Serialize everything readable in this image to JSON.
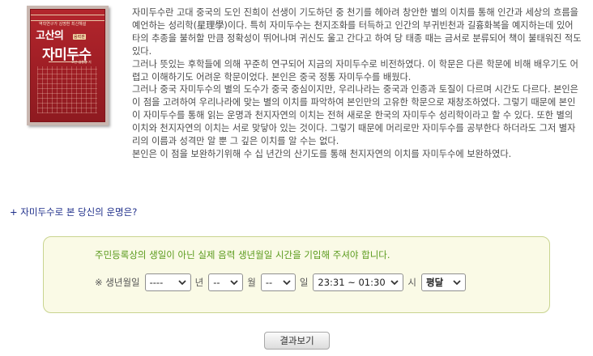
{
  "book_cover": {
    "subtitle": "역학연구가 김명환 최신해설",
    "title_line1": "고산의",
    "tag": "음력판",
    "title_line2": "자미두수",
    "author": "고산 김종웅 저"
  },
  "intro": {
    "paragraphs": [
      "자미두수란 고대 중국의 도인 진희이 선생이 기도하던 중 천기를 헤아려 창안한 별의 이치를 통해 인간과 세상의 흐름을 예언하는 성리학(星理學)이다. 특히 자미두수는 천지조화를 터득하고 인간의 부귀빈천과 길흉화복을 예지하는데 있어 타의 추종을 불허할 만큼 정확성이 뛰어나며 귀신도 울고 간다고 하여 당 태종 때는 금서로 분류되어 책이 불태워진 적도 있다.",
      "그러나 뜻있는 후학들에 의해 꾸준히 연구되어 지금의 자미두수로 비전하였다. 이 학문은 다른 학문에 비해 배우기도 어렵고 이해하기도 어려운 학문이었다. 본인은 중국 정통 자미두수를 배웠다.",
      "그러나 중국 자미두수의 별의 도수가 중국 중심이지만, 우리나라는 중국과 인종과 토질이 다르며 시간도 다르다. 본인은 이 점을 고려하여 우리나라에 맞는 별의 이치를 파악하여 본인만의 고유한 학문으로 재창조하였다. 그렇기 때문에 본인이 자미두수를 통해 읽는 운명과 천지자연의 이치는 전혀 새로운 한국의 자미두수 성리학이라고 할 수 있다. 또한 별의 이치와 천지자연의 이치는 서로 맞닿아 있는 것이다. 그렇기 때문에 머리로만 자미두수를 공부한다 하더라도 그저 별자리의 이름과 성격만 알 뿐 그 깊은 이치를 알 수는 없다.",
      "본인은 이 점을 보완하기위해 수 십 년간의 산기도를 통해 천지자연의 이치를 자미두수에 보완하였다."
    ]
  },
  "section_link": "+ 자미두수로 본 당신의 운명은?",
  "form": {
    "notice": "주민등록상의 생일이 아닌 실제 음력 생년월일 시간을 기입해 주셔야 합니다.",
    "birth_label": "※ 생년월일",
    "year_value": "----",
    "year_unit": "년",
    "month_value": "--",
    "month_unit": "월",
    "day_value": "--",
    "day_unit": "일",
    "time_value": "23:31 ~ 01:30",
    "time_unit": "시",
    "leap_value": "평달"
  },
  "result_button": "결과보기"
}
